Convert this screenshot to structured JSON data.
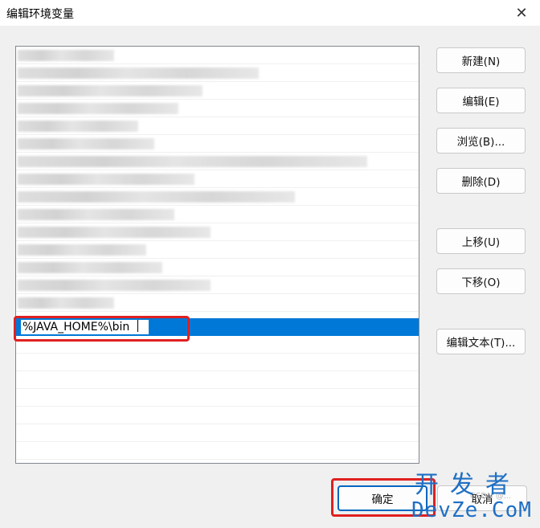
{
  "window": {
    "title": "编辑环境变量",
    "close_glyph": "✕"
  },
  "list": {
    "selected_value": "%JAVA_HOME%\\bin"
  },
  "buttons": {
    "new": "新建(N)",
    "edit": "编辑(E)",
    "browse": "浏览(B)...",
    "delete": "删除(D)",
    "move_up": "上移(U)",
    "move_down": "下移(O)",
    "edit_text": "编辑文本(T)...",
    "ok": "确定",
    "cancel": "取消"
  },
  "watermark": {
    "top": "开发者",
    "bottom": "DevZe.CoM",
    "faint": "CSDN @..."
  },
  "colors": {
    "selection": "#0078d7",
    "highlight": "#e02020",
    "accent": "#0067c0"
  }
}
